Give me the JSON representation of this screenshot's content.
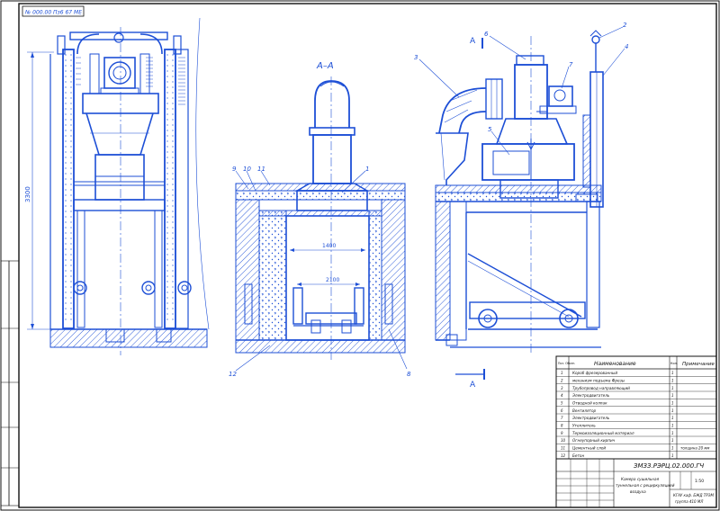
{
  "stamp_code": "№ 000.00 Пз6 67 МЕ",
  "section_label": "А–А",
  "section_arrow_label": "А",
  "dimensions": {
    "height_left": "3300",
    "inner_width": "1400",
    "inner_depth": "2100"
  },
  "section_callouts": [
    "9",
    "10",
    "11",
    "1",
    "12",
    "8"
  ],
  "side_callouts": [
    "6",
    "3",
    "7",
    "2",
    "4",
    "5"
  ],
  "parts_table": {
    "headers": {
      "pos": "Поз. Обозн.",
      "name": "Наименование",
      "qty": "Кол.",
      "note": "Примечание"
    },
    "rows": [
      {
        "pos": "1",
        "name": "Короб фрезерованный",
        "qty": "1",
        "note": ""
      },
      {
        "pos": "2",
        "name": "механизм подъема Фрезы",
        "qty": "1",
        "note": ""
      },
      {
        "pos": "3",
        "name": "Трубопровод направляющий",
        "qty": "1",
        "note": ""
      },
      {
        "pos": "4",
        "name": "Электродвигатель",
        "qty": "1",
        "note": ""
      },
      {
        "pos": "5",
        "name": "Отводной колпак",
        "qty": "1",
        "note": ""
      },
      {
        "pos": "6",
        "name": "Вентилятор",
        "qty": "1",
        "note": ""
      },
      {
        "pos": "7",
        "name": "Электродвигатель",
        "qty": "1",
        "note": ""
      },
      {
        "pos": "8",
        "name": "Утеплитель",
        "qty": "1",
        "note": ""
      },
      {
        "pos": "9",
        "name": "Термоизоляционный материал",
        "qty": "1",
        "note": ""
      },
      {
        "pos": "10",
        "name": "Огнеупорный кирпич",
        "qty": "1",
        "note": ""
      },
      {
        "pos": "11",
        "name": "Цементный слой",
        "qty": "1",
        "note": "толщина 20 мм"
      },
      {
        "pos": "12",
        "name": "Бетон",
        "qty": "1",
        "note": ""
      }
    ]
  },
  "title_block": {
    "doc_code": "ЗМЗЗ.РЭРЦ.02.000.ГЧ",
    "title_line1": "Камера сушильная",
    "title_line2": "туннельная с рециркуляцией",
    "title_line3": "воздуха",
    "scale_label": "1:50",
    "org_line1": "КГАУ каф. БЖД ТРЭМ",
    "org_line2": "группа 410 МЛ"
  }
}
